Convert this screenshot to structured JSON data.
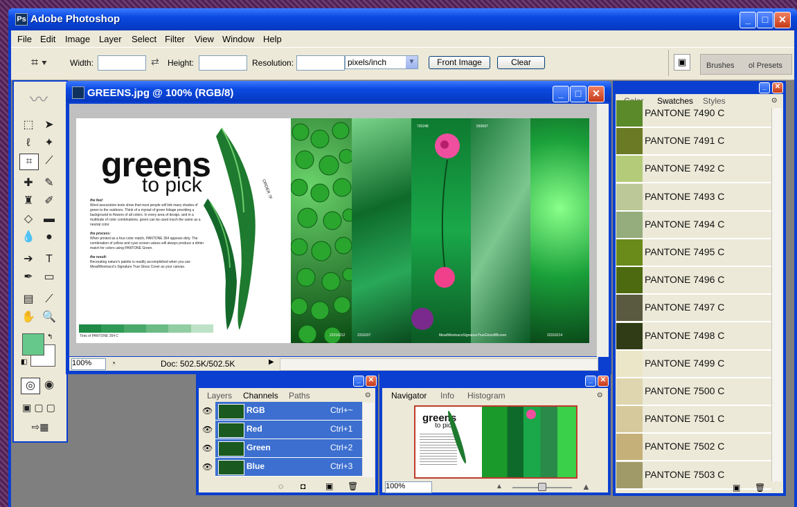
{
  "app": {
    "title": "Adobe Photoshop",
    "logo": "Ps"
  },
  "menu": [
    "File",
    "Edit",
    "Image",
    "Layer",
    "Select",
    "Filter",
    "View",
    "Window",
    "Help"
  ],
  "options": {
    "width_label": "Width:",
    "width_value": "",
    "height_label": "Height:",
    "height_value": "",
    "resolution_label": "Resolution:",
    "resolution_value": "",
    "units": "pixels/inch",
    "front_image": "Front Image",
    "clear": "Clear",
    "brushes_tab": "Brushes",
    "tool_presets_tab": "ol Presets"
  },
  "document": {
    "title": "GREENS.jpg @ 100% (RGB/8)",
    "zoom": "100%",
    "doc_size": "Doc: 502.5K/502.5K",
    "headline_1": "greens",
    "headline_2": "to pick",
    "section1_title": "the feel:",
    "section1_body": "Word association tests show that most people will link many shades of green to the outdoors. Think of a myriad of green foliage providing a background to flowers of all colors. In every area of design, and in a multitude of color combinations, green can be used much the same as a neutral color.",
    "section2_title": "the process:",
    "section2_body": "When printed as a four-color match, PANTONE 354 appears dirty. The combination of yellow and cyan screen values will always produce a dirtier match for colors using PANTONE Green.",
    "section3_title": "the result:",
    "section3_body": "Recreating nature's palette is readily accomplished when you use MeadWestvaco's Signature True Gloss Cover as your canvas.",
    "tints_caption": "Tints of PANTONE 354 C",
    "pepper_label": "ORDER 7F",
    "strip_codes": [
      "720248",
      "593697"
    ],
    "strip_captions": [
      "22316212",
      "2316207",
      "MeadWestvacoSignatureTrueGlossBBcover",
      "22316214"
    ],
    "colors": {
      "ink": "#111111",
      "tint": "#2f9a55"
    }
  },
  "swatches_panel": {
    "tabs": [
      "Color",
      "Swatches",
      "Styles"
    ],
    "active": "Swatches",
    "items": [
      {
        "name": "PANTONE 7490 C",
        "color": "#5a8a2a"
      },
      {
        "name": "PANTONE 7491 C",
        "color": "#6a7a25"
      },
      {
        "name": "PANTONE 7492 C",
        "color": "#b4cc7a"
      },
      {
        "name": "PANTONE 7493 C",
        "color": "#bcc898"
      },
      {
        "name": "PANTONE 7494 C",
        "color": "#95ac7c"
      },
      {
        "name": "PANTONE 7495 C",
        "color": "#6a8a1a"
      },
      {
        "name": "PANTONE 7496 C",
        "color": "#4d6a10"
      },
      {
        "name": "PANTONE 7497 C",
        "color": "#5a5a40"
      },
      {
        "name": "PANTONE 7498 C",
        "color": "#2f3c16"
      },
      {
        "name": "PANTONE 7499 C",
        "color": "#ece6c8"
      },
      {
        "name": "PANTONE 7500 C",
        "color": "#dfd6b0"
      },
      {
        "name": "PANTONE 7501 C",
        "color": "#d6ca9c"
      },
      {
        "name": "PANTONE 7502 C",
        "color": "#c6b07a"
      },
      {
        "name": "PANTONE 7503 C",
        "color": "#a09a68"
      }
    ]
  },
  "channels_panel": {
    "tabs": [
      "Layers",
      "Channels",
      "Paths"
    ],
    "active": "Channels",
    "rows": [
      {
        "name": "RGB",
        "shortcut": "Ctrl+~"
      },
      {
        "name": "Red",
        "shortcut": "Ctrl+1"
      },
      {
        "name": "Green",
        "shortcut": "Ctrl+2"
      },
      {
        "name": "Blue",
        "shortcut": "Ctrl+3"
      }
    ]
  },
  "navigator_panel": {
    "tabs": [
      "Navigator",
      "Info",
      "Histogram"
    ],
    "active": "Navigator",
    "zoom": "100%",
    "zoom_level": 0.5,
    "thumb_headline_1": "greens",
    "thumb_headline_2": "to pick"
  },
  "colors": {
    "foreground": "#66c88a",
    "background": "#ffffff",
    "selection": "#3c6fcf",
    "title_blue": "#0a3fd0"
  }
}
